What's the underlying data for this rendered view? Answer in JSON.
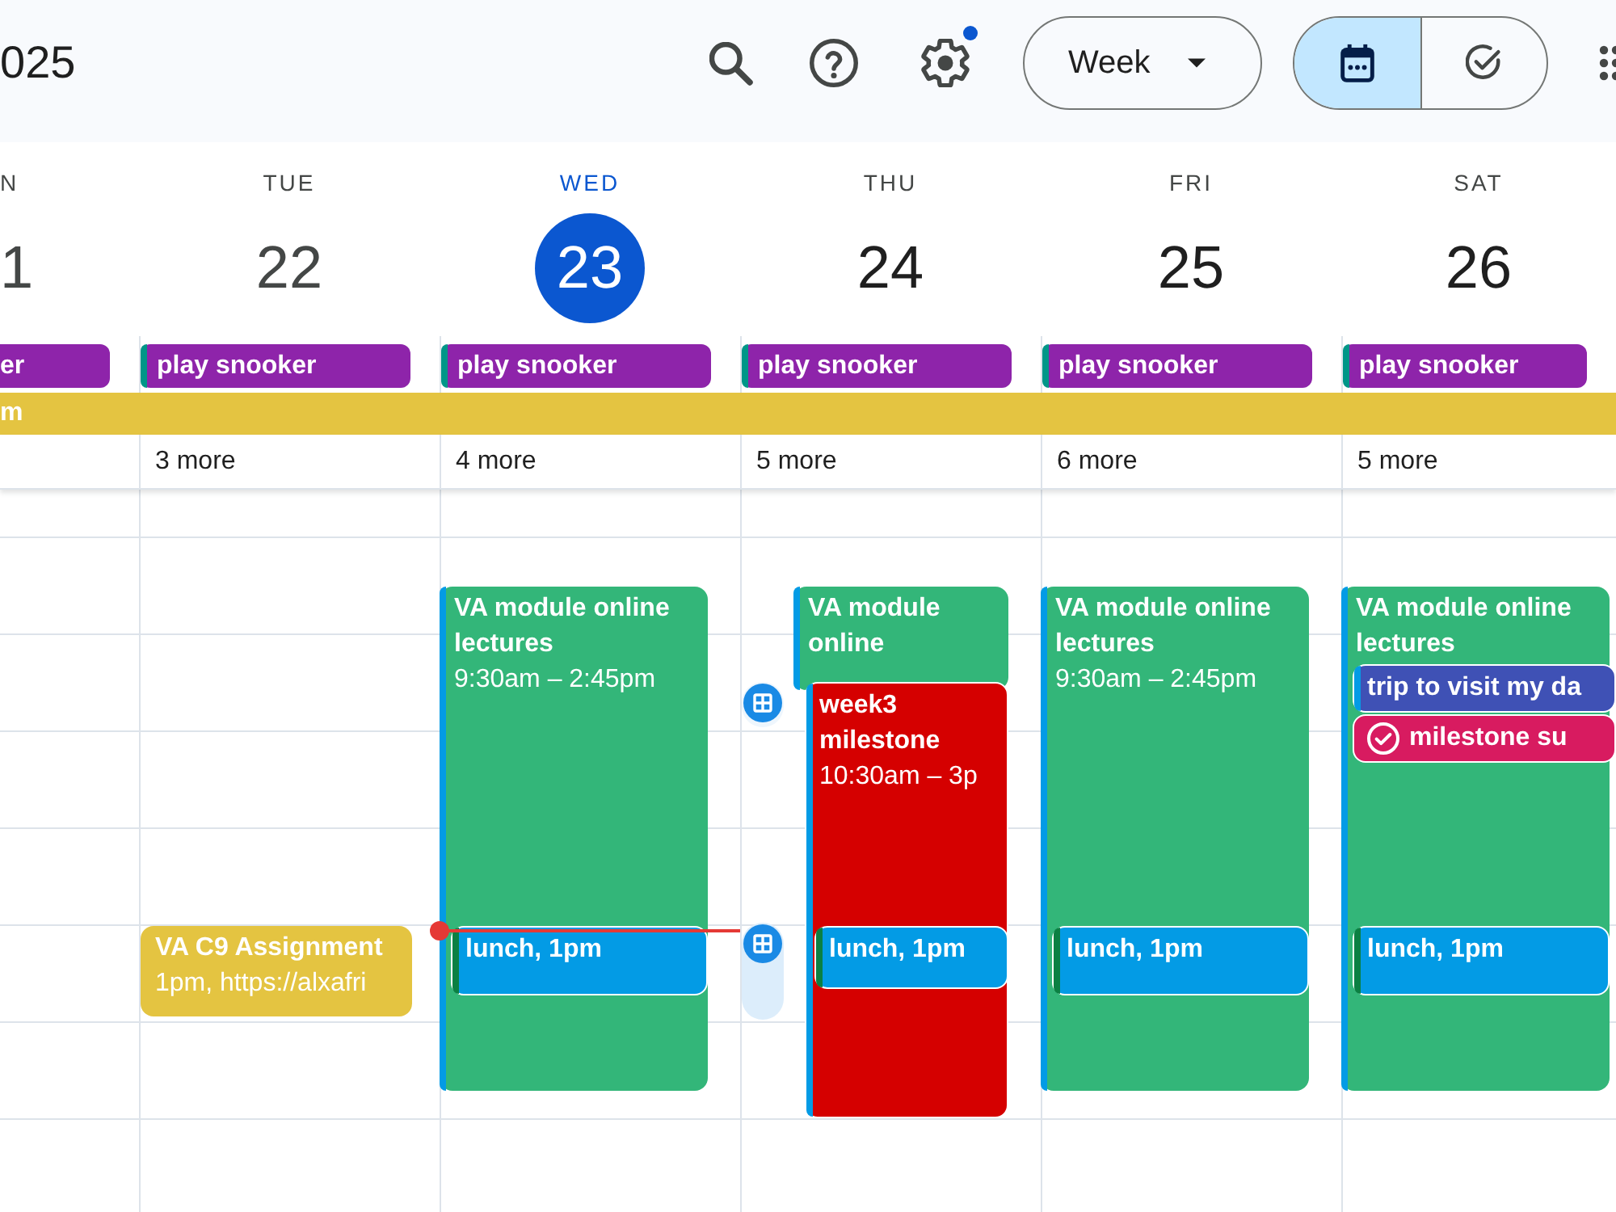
{
  "top_bar": {
    "title": "025",
    "settings_badge": true,
    "view_menu": "Week",
    "view_toggle": [
      {
        "kind": "calendar",
        "selected": true
      },
      {
        "kind": "tasks",
        "selected": false
      }
    ]
  },
  "days": [
    {
      "name": "N",
      "date": "1",
      "past": true,
      "today": false,
      "all_day": [
        {
          "title": "er",
          "color": "#8e24aa"
        }
      ]
    },
    {
      "name": "TUE",
      "date": "22",
      "past": true,
      "today": false,
      "all_day": [
        {
          "title": "play snooker",
          "color": "#8e24aa",
          "stripe": {
            "color": "#009688"
          }
        }
      ],
      "more": "3 more",
      "events": [
        {
          "kind": "event",
          "title": "VA C9 Assignment",
          "time": "1pm, https://alxafri",
          "color": "#e4c441"
        }
      ]
    },
    {
      "name": "WED",
      "date": "23",
      "past": false,
      "today": true,
      "all_day": [
        {
          "title": "play snooker",
          "color": "#8e24aa",
          "stripe": {
            "color": "#009688"
          }
        }
      ],
      "more": "4 more",
      "events": [
        {
          "kind": "event",
          "title": "VA module online lectures",
          "time": "9:30am – 2:45pm",
          "color": "#33b679",
          "stripe": {
            "color": "#039be5"
          }
        },
        {
          "kind": "event",
          "title": "lunch, 1pm",
          "color": "#039be5",
          "stripe": {
            "color": "#0b8043"
          }
        }
      ]
    },
    {
      "name": "THU",
      "date": "24",
      "past": false,
      "today": false,
      "all_day": [
        {
          "title": "play snooker",
          "color": "#8e24aa",
          "stripe": {
            "color": "#009688"
          }
        }
      ],
      "more": "5 more",
      "events": [
        {
          "kind": "marker",
          "highlighted": false
        },
        {
          "kind": "marker",
          "highlighted": true
        },
        {
          "kind": "event",
          "title": "VA module online",
          "color": "#33b679",
          "stripe": {
            "color": "#039be5"
          }
        },
        {
          "kind": "event",
          "title": "week3 milestone",
          "time": "10:30am – 3p",
          "color": "#d50000",
          "stripe": {
            "color": "#039be5"
          }
        },
        {
          "kind": "event",
          "title": "lunch, 1pm",
          "color": "#039be5",
          "stripe": {
            "color": "#0b8043"
          }
        }
      ]
    },
    {
      "name": "FRI",
      "date": "25",
      "past": false,
      "today": false,
      "all_day": [
        {
          "title": "play snooker",
          "color": "#8e24aa",
          "stripe": {
            "color": "#009688"
          }
        }
      ],
      "more": "6 more",
      "events": [
        {
          "kind": "event",
          "title": "VA module online lectures",
          "time": "9:30am – 2:45pm",
          "color": "#33b679",
          "stripe": {
            "color": "#039be5"
          }
        },
        {
          "kind": "event",
          "title": "lunch, 1pm",
          "color": "#039be5",
          "stripe": {
            "color": "#0b8043"
          }
        }
      ]
    },
    {
      "name": "SAT",
      "date": "26",
      "past": false,
      "today": false,
      "all_day": [
        {
          "title": "play snooker",
          "color": "#8e24aa",
          "stripe": {
            "color": "#009688"
          }
        }
      ],
      "more": "5 more",
      "events": [
        {
          "kind": "event",
          "title": "VA module online lectures",
          "color": "#33b679",
          "stripe": {
            "color": "#039be5"
          }
        },
        {
          "kind": "event",
          "title": "trip to visit my da",
          "color": "#3f51b5",
          "stripe": {
            "color": "#039be5"
          }
        },
        {
          "kind": "task",
          "title": "milestone su",
          "color": "#d81b60"
        },
        {
          "kind": "event",
          "title": "lunch, 1pm",
          "color": "#039be5",
          "stripe": {
            "color": "#0b8043"
          }
        }
      ]
    }
  ],
  "spanning_event": {
    "title": "m",
    "color": "#e4c441"
  }
}
